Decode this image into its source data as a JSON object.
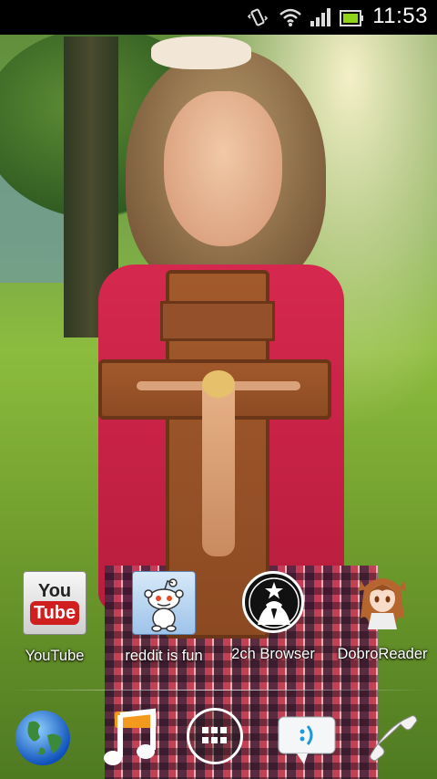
{
  "status_bar": {
    "time": "11:53",
    "icons": [
      "vibrate-icon",
      "wifi-icon",
      "signal-icon",
      "battery-icon"
    ]
  },
  "wallpaper": {
    "description_icon": "photo-wallpaper"
  },
  "home_apps": [
    {
      "label": "YouTube",
      "icon": "youtube-icon"
    },
    {
      "label": "reddit is fun",
      "icon": "reddit-alien-icon"
    },
    {
      "label": "2ch Browser",
      "icon": "anonymous-mask-icon"
    },
    {
      "label": "DobroReader",
      "icon": "anime-girl-icon"
    }
  ],
  "youtube_logo": {
    "top": "You",
    "bottom": "Tube",
    "accent": "#d01f1f"
  },
  "dock": [
    {
      "icon": "globe-browser-icon"
    },
    {
      "icon": "music-note-icon"
    },
    {
      "icon": "app-drawer-icon"
    },
    {
      "icon": "messages-icon"
    },
    {
      "icon": "phone-icon"
    }
  ]
}
